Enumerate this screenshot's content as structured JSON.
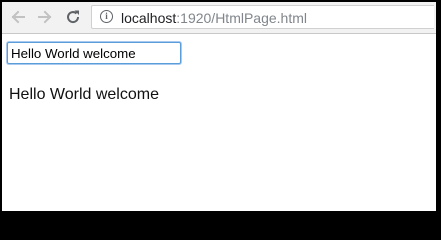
{
  "toolbar": {
    "back_icon": "arrow-left-icon",
    "forward_icon": "arrow-right-icon",
    "reload_icon": "reload-icon",
    "info_icon": "info-icon",
    "info_glyph": "i",
    "url_host": "localhost",
    "url_path": ":1920/HtmlPage.html",
    "back_enabled": false,
    "forward_enabled": false
  },
  "page": {
    "input_value": "Hello World welcome",
    "output_text": "Hello World welcome"
  }
}
